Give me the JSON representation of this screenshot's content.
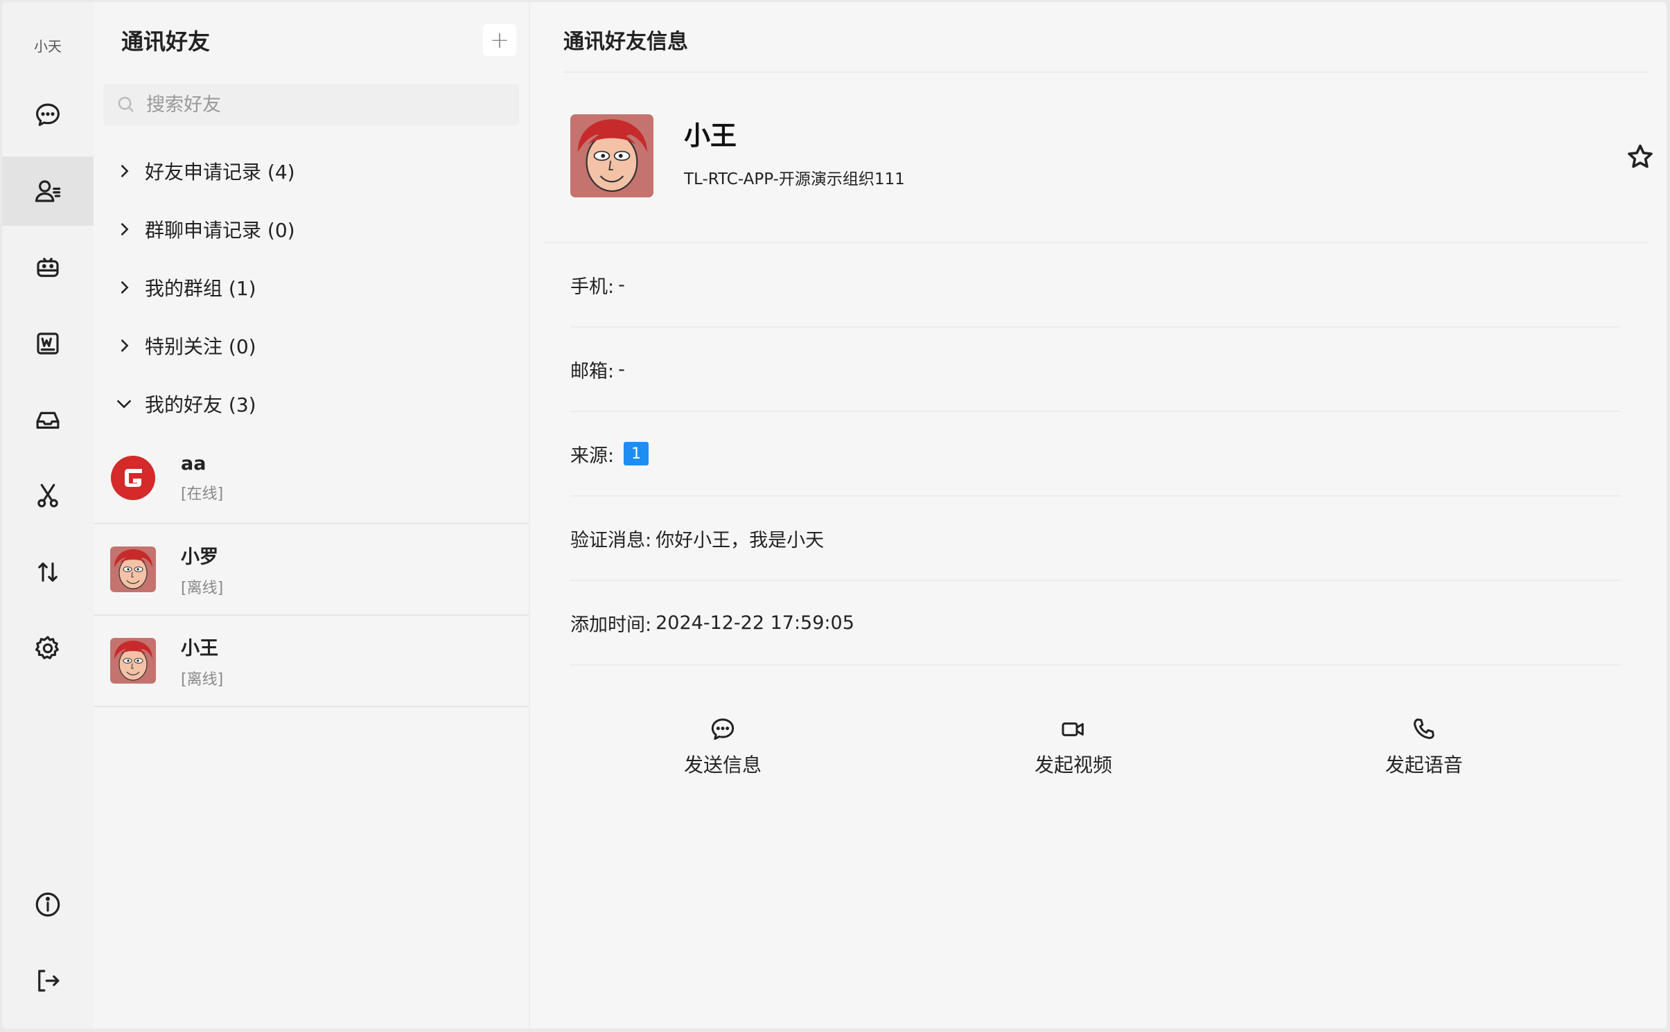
{
  "user": {
    "name": "小天"
  },
  "rail": {
    "items": [
      {
        "name": "chat-bubble-icon"
      },
      {
        "name": "contacts-icon"
      },
      {
        "name": "robot-icon"
      },
      {
        "name": "word-doc-icon"
      },
      {
        "name": "inbox-icon"
      },
      {
        "name": "scissors-icon"
      },
      {
        "name": "transfer-arrows-icon"
      },
      {
        "name": "gear-icon"
      },
      {
        "name": "info-icon"
      },
      {
        "name": "logout-icon"
      }
    ]
  },
  "contacts": {
    "title": "通讯好友",
    "add_label": "+",
    "search": {
      "placeholder": "搜索好友",
      "value": ""
    },
    "groups": [
      {
        "label": "好友申请记录 (4)",
        "expanded": false
      },
      {
        "label": "群聊申请记录 (0)",
        "expanded": false
      },
      {
        "label": "我的群组 (1)",
        "expanded": false
      },
      {
        "label": "特别关注 (0)",
        "expanded": false
      },
      {
        "label": "我的好友 (3)",
        "expanded": true
      }
    ],
    "friends": [
      {
        "name": "aa",
        "status": "[在线]",
        "avatar": "g-logo"
      },
      {
        "name": "小罗",
        "status": "[离线]",
        "avatar": "face"
      },
      {
        "name": "小王",
        "status": "[离线]",
        "avatar": "face"
      }
    ]
  },
  "detail": {
    "title": "通讯好友信息",
    "profile": {
      "name": "小王",
      "org": "TL-RTC-APP-开源演示组织111"
    },
    "fields": {
      "phone_label": "手机:",
      "phone_value": "-",
      "email_label": "邮箱:",
      "email_value": "-",
      "source_label": "来源:",
      "source_value": "1",
      "verify_label": "验证消息:",
      "verify_value": "你好小王，我是小天",
      "added_label": "添加时间:",
      "added_value": "2024-12-22 17:59:05"
    },
    "actions": {
      "message": "发送信息",
      "video": "发起视频",
      "voice": "发起语音"
    }
  },
  "colors": {
    "accent": "#1f8ef1",
    "logo_red": "#d42a2a"
  }
}
